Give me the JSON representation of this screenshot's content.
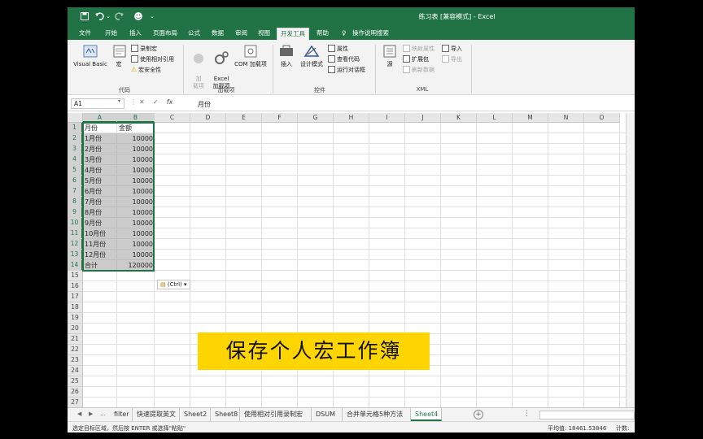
{
  "window": {
    "title": "练习表  [兼容模式]  -  Excel"
  },
  "qat": {
    "save_icon": "save-icon",
    "undo_icon": "undo-icon",
    "redo_icon": "redo-icon",
    "smiley": "☻",
    "dropdown": "⌄"
  },
  "tabs": [
    "文件",
    "开始",
    "插入",
    "页面布局",
    "公式",
    "数据",
    "审阅",
    "视图",
    "开发工具",
    "帮助",
    "操作说明搜索"
  ],
  "ribbon": {
    "code_group": {
      "label": "代码",
      "visual_basic": "Visual Basic",
      "macro": "宏",
      "record": "录制宏",
      "relative": "使用相对引用",
      "security": "宏安全性"
    },
    "addins_group": {
      "label": "加载项",
      "addin": "加\n载项",
      "excel_addin": "Excel\n加载项",
      "com_addin": "COM 加载项"
    },
    "controls_group": {
      "label": "控件",
      "insert": "插入",
      "design": "设计模式",
      "props": "属性",
      "view_code": "查看代码",
      "run_dialog": "运行对话框"
    },
    "xml_group": {
      "label": "XML",
      "source": "源",
      "map_props": "映射属性",
      "expand": "扩展包",
      "refresh": "刷新数据",
      "import": "导入",
      "export": "导出"
    }
  },
  "formula_bar": {
    "name_box": "A1",
    "value": "月份",
    "fx": "fx"
  },
  "columns": [
    "A",
    "B",
    "C",
    "D",
    "E",
    "F",
    "G",
    "H",
    "I",
    "J",
    "K",
    "L",
    "M",
    "N",
    "O"
  ],
  "rows": [
    "1",
    "2",
    "3",
    "4",
    "5",
    "6",
    "7",
    "8",
    "9",
    "10",
    "11",
    "12",
    "13",
    "14",
    "15",
    "16",
    "17",
    "18",
    "19",
    "20",
    "21",
    "22",
    "23",
    "24",
    "25",
    "26",
    "27"
  ],
  "table": [
    [
      "月份",
      "金额"
    ],
    [
      "1月份",
      "10000"
    ],
    [
      "2月份",
      "10000"
    ],
    [
      "3月份",
      "10000"
    ],
    [
      "4月份",
      "10000"
    ],
    [
      "5月份",
      "10000"
    ],
    [
      "6月份",
      "10000"
    ],
    [
      "7月份",
      "10000"
    ],
    [
      "8月份",
      "10000"
    ],
    [
      "9月份",
      "10000"
    ],
    [
      "10月份",
      "10000"
    ],
    [
      "11月份",
      "10000"
    ],
    [
      "12月份",
      "10000"
    ],
    [
      "合计",
      "120000"
    ]
  ],
  "paste_options": "(Ctrl) ▾",
  "caption": "保存个人宏工作簿",
  "sheets": [
    "filter",
    "快速提取英文",
    "Sheet2",
    "Sheet8",
    "使用相对引用录制宏",
    "DSUM",
    "合并单元格5种方法",
    "Sheet4"
  ],
  "active_sheet": "Sheet4",
  "status": {
    "message": "选定目标区域，然后按 ENTER 或选择\"粘贴\"",
    "average": "平均值: 18461.53846",
    "count": "计数:"
  },
  "colors": {
    "accent": "#217346",
    "caption_bg": "#ffd500"
  }
}
